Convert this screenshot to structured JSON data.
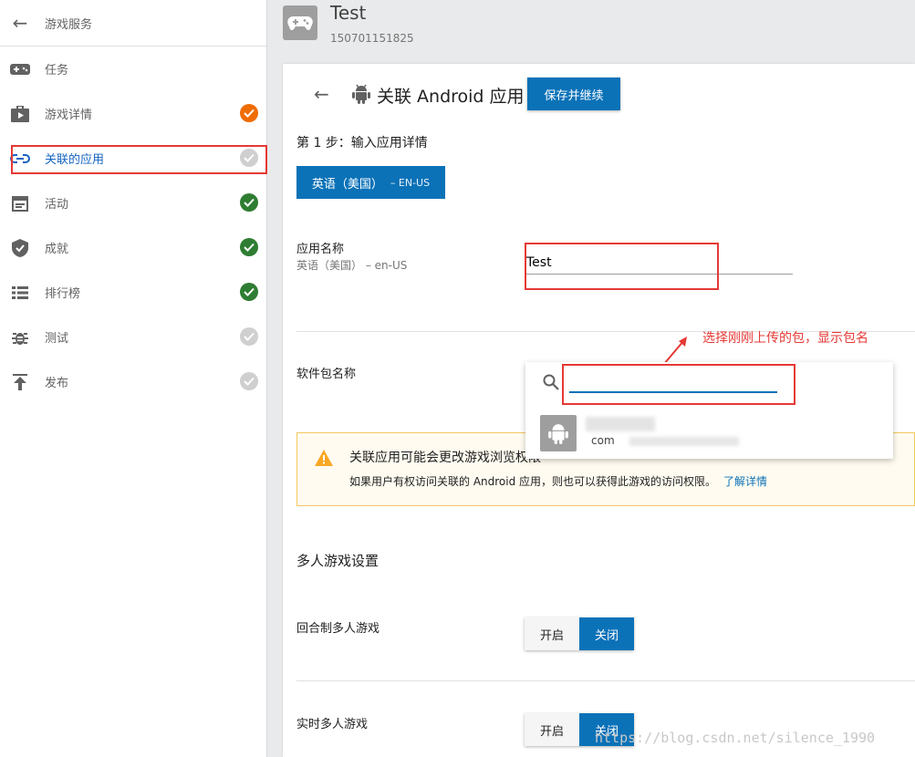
{
  "sidebar": {
    "header": "游戏服务",
    "items": [
      {
        "label": "任务",
        "status": "none"
      },
      {
        "label": "游戏详情",
        "status": "orange"
      },
      {
        "label": "关联的应用",
        "status": "grey"
      },
      {
        "label": "活动",
        "status": "green"
      },
      {
        "label": "成就",
        "status": "green"
      },
      {
        "label": "排行榜",
        "status": "green"
      },
      {
        "label": "测试",
        "status": "grey"
      },
      {
        "label": "发布",
        "status": "grey"
      }
    ]
  },
  "game": {
    "title": "Test",
    "id": "150701151825"
  },
  "page": {
    "title": "关联 Android 应用",
    "save_label": "保存并继续",
    "step": "第 1 步：输入应用详情",
    "lang_label": "英语（美国）",
    "lang_code": "– EN-US"
  },
  "app_name": {
    "label": "应用名称",
    "sub": "英语（美国）  – en-US",
    "value": "Test"
  },
  "package": {
    "label": "软件包名称",
    "suggestion_prefix": "com"
  },
  "annotation": "选择刚刚上传的包，显示包名",
  "warning": {
    "title": "关联应用可能会更改游戏浏览权限",
    "body": "如果用户有权访问关联的 Android 应用，则也可以获得此游戏的访问权限。",
    "link": "了解详情"
  },
  "multiplayer": {
    "title": "多人游戏设置",
    "turn_based": {
      "label": "回合制多人游戏",
      "on": "开启",
      "off": "关闭",
      "selected": "off"
    },
    "realtime": {
      "label": "实时多人游戏",
      "on": "开启",
      "off": "关闭",
      "selected": "off"
    }
  },
  "watermark": "https://blog.csdn.net/silence_1990",
  "colors": {
    "accent": "#0b72b8",
    "alert": "#e53935",
    "ok": "#2e7d32",
    "warn": "#ef6c00"
  }
}
